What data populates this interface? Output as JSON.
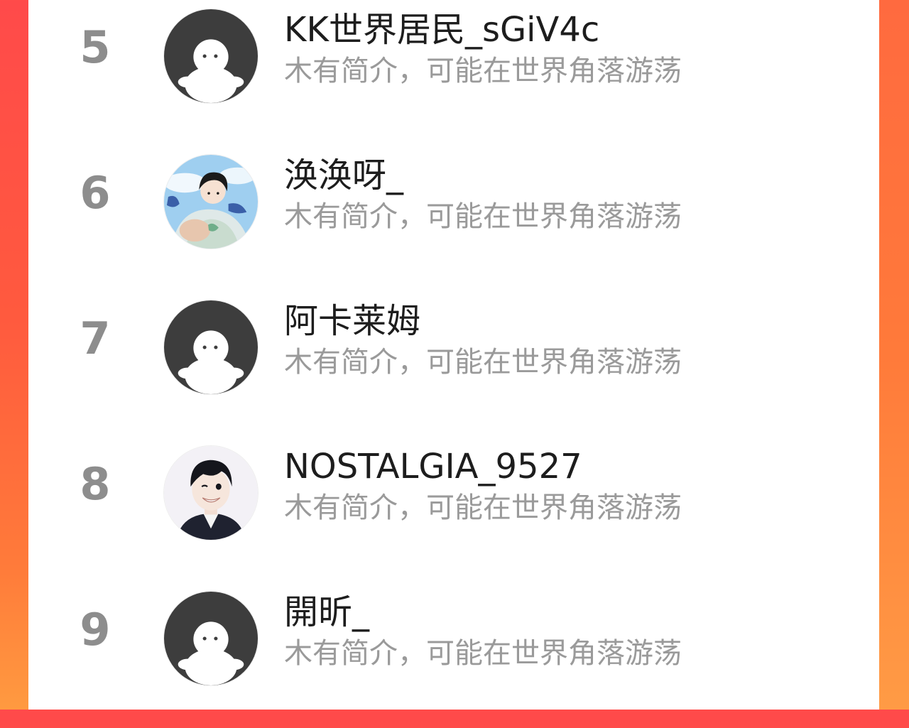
{
  "ranking": [
    {
      "rank": "5",
      "name": "KK世界居民_sGiV4c",
      "bio": "木有简介，可能在世界角落游荡",
      "avatar_icon": "default-avatar-icon"
    },
    {
      "rank": "6",
      "name": "涣涣呀_",
      "bio": "木有简介，可能在世界角落游荡",
      "avatar_icon": "illustrated-avatar-icon"
    },
    {
      "rank": "7",
      "name": "阿卡莱姆",
      "bio": "木有简介，可能在世界角落游荡",
      "avatar_icon": "default-avatar-icon"
    },
    {
      "rank": "8",
      "name": "NOSTALGIA_9527",
      "bio": "木有简介，可能在世界角落游荡",
      "avatar_icon": "anime-avatar-icon"
    },
    {
      "rank": "9",
      "name": "開昕_",
      "bio": "木有简介，可能在世界角落游荡",
      "avatar_icon": "default-avatar-icon"
    }
  ],
  "colors": {
    "background_gradient_top": "#ff4a4a",
    "background_gradient_bottom": "#ff9a40",
    "rank_text": "#8d8d8d",
    "name_text": "#1d1d1d",
    "bio_text": "#9a9a9a",
    "default_avatar_bg": "#3d3d3d"
  }
}
